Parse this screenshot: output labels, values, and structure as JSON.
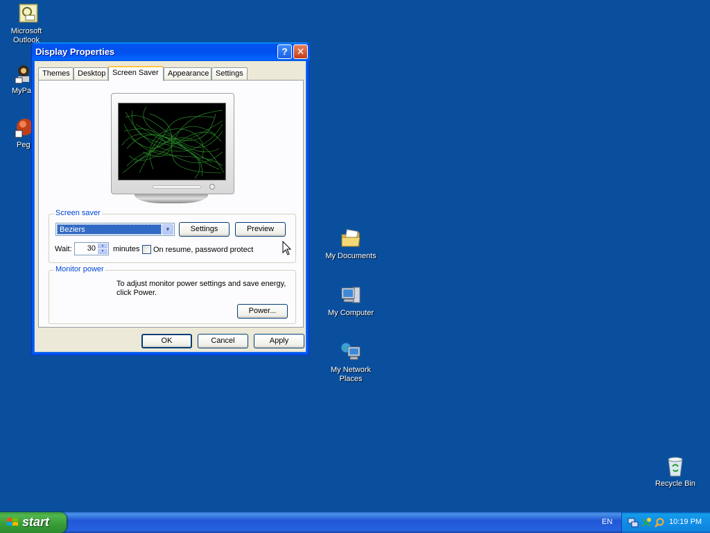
{
  "desktop": {
    "icons_left": [
      {
        "label": "Microsoft Outlook",
        "icon": "outlook-icon"
      },
      {
        "label": "MyPa",
        "icon": "mypal-icon"
      },
      {
        "label": "Peg",
        "icon": "pegasus-icon"
      }
    ],
    "icons_mid": [
      {
        "label": "My Documents",
        "icon": "folder-icon"
      },
      {
        "label": "My Computer",
        "icon": "computer-icon"
      },
      {
        "label": "My Network Places",
        "icon": "network-icon"
      }
    ],
    "recycle_bin": {
      "label": "Recycle Bin",
      "icon": "recycle-bin-icon"
    }
  },
  "window": {
    "title": "Display Properties",
    "help_glyph": "?",
    "close_glyph": "✕",
    "tabs": [
      {
        "label": "Themes"
      },
      {
        "label": "Desktop"
      },
      {
        "label": "Screen Saver",
        "active": true
      },
      {
        "label": "Appearance"
      },
      {
        "label": "Settings"
      }
    ],
    "screen_saver": {
      "group_label": "Screen saver",
      "selected": "Beziers",
      "settings_button": "Settings",
      "preview_button": "Preview",
      "wait_label": "Wait:",
      "wait_value": "30",
      "minutes_label": "minutes",
      "password_checkbox_label": "On resume, password protect",
      "password_checked": false
    },
    "monitor_power": {
      "group_label": "Monitor power",
      "description": "To adjust monitor power settings and save energy, click Power.",
      "power_button": "Power..."
    },
    "buttons": {
      "ok": "OK",
      "cancel": "Cancel",
      "apply": "Apply"
    }
  },
  "taskbar": {
    "start_label": "start",
    "language": "EN",
    "clock": "10:19 PM"
  },
  "colors": {
    "desktop": "#0a4f9e",
    "titlebar": "#0053ee",
    "dialog": "#ece9d8",
    "selection": "#316ac5",
    "start_green": "#3c9b3c"
  }
}
